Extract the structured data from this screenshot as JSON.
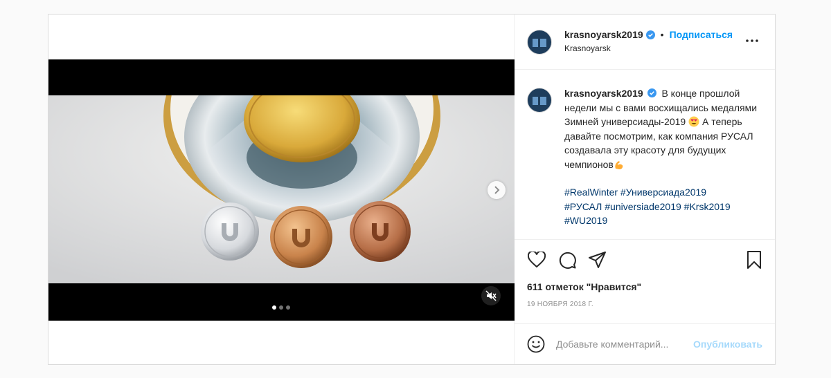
{
  "post": {
    "author": {
      "username": "krasnoyarsk2019",
      "follow_label": "Подписаться",
      "separator": "•",
      "location": "Krasnoyarsk"
    },
    "caption": {
      "username": "krasnoyarsk2019",
      "text_1": "В конце прошлой недели мы с вами восхищались медалями Зимней универсиады-2019",
      "text_2": "А теперь давайте посмотрим, как компания РУСАЛ создавала эту красоту для будущих чемпионов",
      "hashtags": [
        "#RealWinter",
        "#Универсиада2019",
        "#РУСАЛ",
        "#universiade2019",
        "#Krsk2019",
        "#WU2019"
      ]
    },
    "likes_text": "611 отметок \"Нравится\"",
    "date_text": "19 НОЯБРЯ 2018 Г.",
    "comment": {
      "placeholder": "Добавьте комментарий...",
      "publish_label": "Опубликовать"
    },
    "media": {
      "carousel_total": 3,
      "carousel_active": 1
    }
  },
  "icons": {
    "verified": "verified-badge-icon",
    "more": "more-options-icon",
    "like": "heart-icon",
    "comment": "comment-icon",
    "share": "paper-plane-icon",
    "save": "bookmark-icon",
    "emoji": "smiley-icon",
    "mute": "muted-speaker-icon",
    "next": "chevron-right-icon"
  },
  "colors": {
    "accent": "#0095f6",
    "hashtag": "#00376b",
    "verified": "#3897f0"
  }
}
